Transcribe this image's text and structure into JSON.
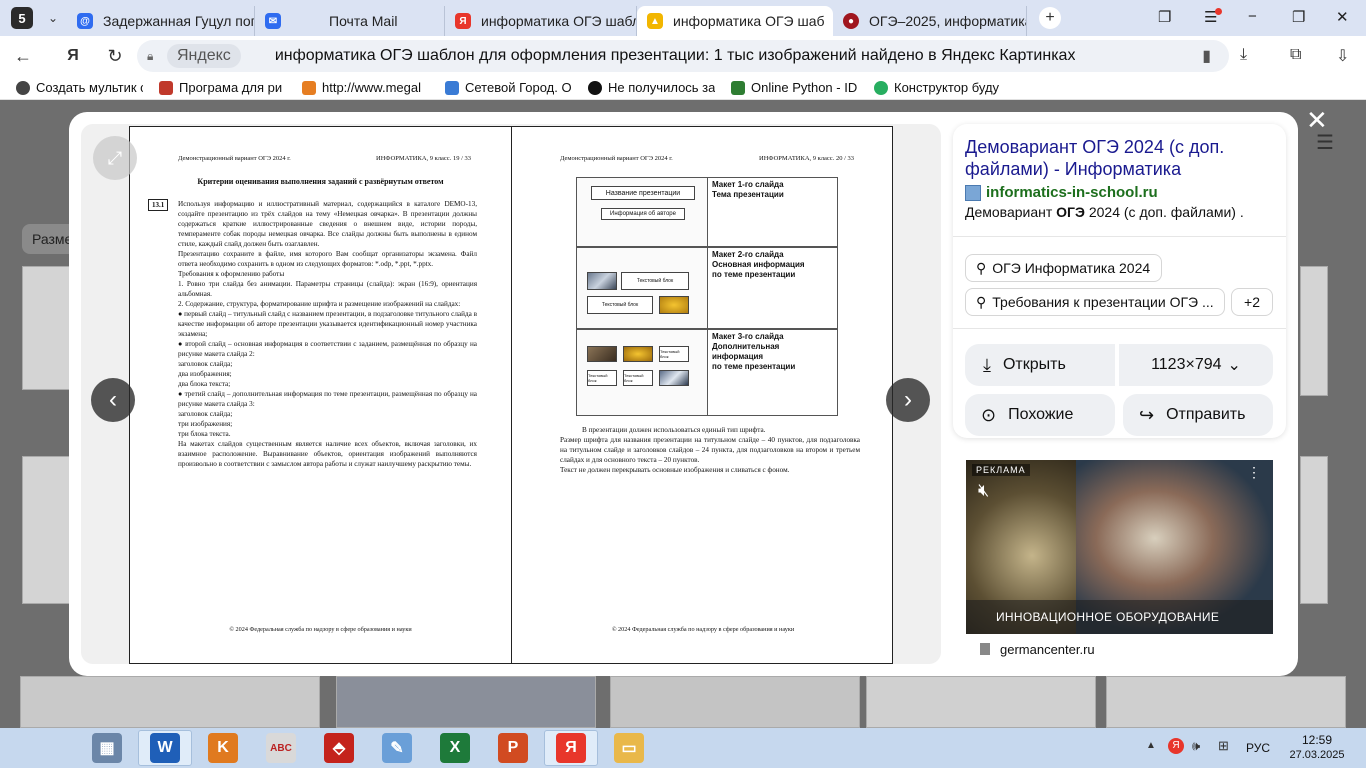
{
  "browser": {
    "tab_count": "5",
    "tabs": [
      {
        "label": "Задержанная Гуцул попр",
        "color": "#2f6cf0"
      },
      {
        "label": "Почта Mail",
        "color": "#2f6cf0"
      },
      {
        "label": "информатика ОГЭ шабло",
        "color": "#e8362b"
      },
      {
        "label": "информатика ОГЭ шаб",
        "color": "#f2b600"
      },
      {
        "label": "ОГЭ–2025, информатика",
        "color": "#a0161f"
      }
    ],
    "window_controls": [
      "−",
      "❐",
      "✕"
    ],
    "address": {
      "site_chip": "Яндекс",
      "title": "информатика ОГЭ шаблон для оформления презентации: 1 тыс изображений найдено в Яндекс Картинках"
    },
    "bookmarks": [
      {
        "label": "Создать мультик с",
        "color": "#444444"
      },
      {
        "label": "Програма для ри",
        "color": "#c0392b"
      },
      {
        "label": "http://www.megal",
        "color": "#e67e22"
      },
      {
        "label": "Сетевой Город. О",
        "color": "#3a7bd5"
      },
      {
        "label": "Не получилось заг",
        "color": "#111111"
      },
      {
        "label": "Online Python - IDE",
        "color": "#2e7d32"
      },
      {
        "label": "Конструктор буду",
        "color": "#27ae60"
      }
    ]
  },
  "background": {
    "filter_label": "Разме"
  },
  "viewer": {
    "left_page": {
      "header_left": "Демонстрационный вариант ОГЭ 2024 г.",
      "header_right": "ИНФОРМАТИКА, 9 класс.     19 / 33",
      "title": "Критерии оценивания выполнения заданий с развёрнутым ответом",
      "task_no": "13.1",
      "body": "Используя информацию и иллюстративный материал, содержащийся в каталоге DEMO-13, создайте презентацию из трёх слайдов на тему «Немецкая овчарка». В презентации должны содержаться краткие иллюстрированные сведения о внешнем виде, истории породы, темпераменте собак породы немецкая овчарка. Все слайды должны быть выполнены в едином стиле, каждый слайд должен быть озаглавлен.\nПрезентацию сохраните в файле, имя которого Вам сообщат организаторы экзамена. Файл ответа необходимо сохранить в одном из следующих форматов: *.odp, *.ppt, *.pptx.\nТребования к оформлению работы\n1. Ровно три слайда без анимации. Параметры страницы (слайда): экран (16:9), ориентация альбомная.\n2. Содержание, структура, форматирование шрифта и размещение изображений на слайдах:\n● первый слайд – титульный слайд с названием презентации, в подзаголовке титульного слайда в качестве информации об авторе презентации указывается идентификационный номер участника экзамена;\n● второй слайд – основная информация в соответствии с заданием, размещённая по образцу на рисунке макета слайда 2:\n    заголовок слайда;\n    два изображения;\n    два блока текста;\n● третий слайд – дополнительная информация по теме презентации, размещённая по образцу на рисунке макета слайда 3:\n    заголовок слайда;\n    три изображения;\n    три блока текста.\nНа макетах слайдов существенным является наличие всех объектов, включая заголовки, их взаимное расположение. Выравнивание объектов, ориентация изображений выполняются произвольно в соответствии с замыслом автора работы и служат наилучшему раскрытию темы.",
      "footer": "© 2024 Федеральная служба по надзору в сфере образования и науки"
    },
    "right_page": {
      "header_left": "Демонстрационный вариант ОГЭ 2024 г.",
      "header_right": "ИНФОРМАТИКА, 9 класс.     20 / 33",
      "mockups": [
        {
          "label": "Макет 1-го слайда\nТема презентации",
          "box1": "Название презентации",
          "box2": "Информация об авторе"
        },
        {
          "label": "Макет 2-го слайда\nОсновная информация\nпо теме презентации",
          "box1": "Текстовый блок",
          "box2": "Текстовый блок"
        },
        {
          "label": "Макет 3-го слайда\nДополнительная\nинформация\nпо теме презентации",
          "box1": "Текстовый блок",
          "box2": "Текстовый блок",
          "box3": "Текстовый блок"
        }
      ],
      "body": "В презентации должен использоваться единый тип шрифта.\nРазмер шрифта для названия презентации на титульном слайде – 40 пунктов, для подзаголовка на титульном слайде и заголовков слайдов – 24 пункта, для подзаголовков на втором и третьем слайдах и для основного текста – 20 пунктов.\nТекст не должен перекрывать основные изображения и сливаться с фоном.",
      "footer": "© 2024 Федеральная служба по надзору в сфере образования и науки"
    }
  },
  "side": {
    "title": "Демовариант ОГЭ 2024 (с доп. файлами) - Информатика",
    "domain": "informatics-in-school.ru",
    "description_pre": "Демовариант ",
    "description_bold": "ОГЭ",
    "description_post": " 2024 (с доп. файлами) .",
    "tags": [
      "ОГЭ Информатика 2024",
      "Требования к презентации ОГЭ ..."
    ],
    "more_tags": "+2",
    "open_label": "Открыть",
    "size_label": "1123×794",
    "similar_label": "Похожие",
    "share_label": "Отправить"
  },
  "ad": {
    "badge": "РЕКЛАМА",
    "caption": "ИННОВАЦИОННОЕ ОБОРУДОВАНИЕ",
    "domain": "germancenter.ru"
  },
  "taskbar": {
    "apps": [
      {
        "name": "calculator-app",
        "glyph": "▦",
        "color": "#6b86a8"
      },
      {
        "name": "word-app",
        "glyph": "W",
        "color": "#1f5fb8"
      },
      {
        "name": "kumir-app",
        "glyph": "K",
        "color": "#e07a1f"
      },
      {
        "name": "abc-app",
        "glyph": "ABC",
        "color": "#d9d9d9"
      },
      {
        "name": "pdf-app",
        "glyph": "⬘",
        "color": "#c4231c"
      },
      {
        "name": "paint-app",
        "glyph": "✎",
        "color": "#6a9fd8"
      },
      {
        "name": "excel-app",
        "glyph": "X",
        "color": "#1e7a3a"
      },
      {
        "name": "powerpoint-app",
        "glyph": "P",
        "color": "#d14b21"
      },
      {
        "name": "yandex-app",
        "glyph": "Я",
        "color": "#e8362b"
      },
      {
        "name": "explorer-app",
        "glyph": "▭",
        "color": "#e9b84a"
      }
    ],
    "lang": "РУС",
    "time": "12:59",
    "date": "27.03.2025"
  }
}
